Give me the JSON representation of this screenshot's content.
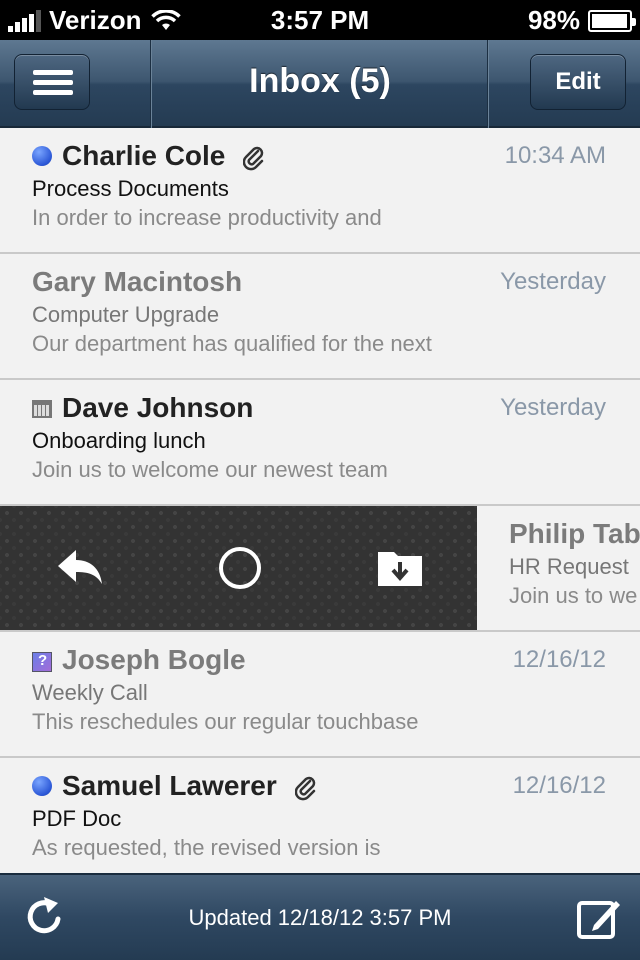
{
  "status_bar": {
    "carrier": "Verizon",
    "time": "3:57 PM",
    "battery": "98%"
  },
  "nav": {
    "title": "Inbox (5)",
    "edit_label": "Edit",
    "menu_icon": "hamburger-icon"
  },
  "messages": [
    {
      "sender": "Charlie Cole",
      "subject": "Process Documents",
      "preview": "In order to increase productivity and",
      "time": "10:34 AM",
      "unread": true,
      "attachment": true
    },
    {
      "sender": "Gary Macintosh",
      "subject": "Computer Upgrade",
      "preview": "Our department has qualified for the next",
      "time": "Yesterday",
      "unread": false,
      "attachment": false
    },
    {
      "sender": "Dave Johnson",
      "subject": "Onboarding lunch",
      "preview": "Join us to welcome our newest team",
      "time": "Yesterday",
      "unread": false,
      "attachment": false,
      "icon": "calendar-icon"
    },
    {
      "sender": "Philip Tab",
      "subject": "HR Request",
      "preview": "Join us to we",
      "swiped": true
    },
    {
      "sender": "Joseph Bogle",
      "subject": "Weekly Call",
      "preview": "This reschedules our regular touchbase",
      "time": "12/16/12",
      "unread": false,
      "icon": "meeting-request-icon"
    },
    {
      "sender": "Samuel Lawerer",
      "subject": "PDF Doc",
      "preview": "As requested, the revised version is",
      "time": "12/16/12",
      "unread": true,
      "attachment": true
    }
  ],
  "swipe_actions": [
    "reply-icon",
    "mark-circle-icon",
    "archive-folder-icon"
  ],
  "toolbar": {
    "updated_text": "Updated 12/18/12 3:57 PM",
    "refresh_icon": "refresh-icon",
    "compose_icon": "compose-icon"
  },
  "colors": {
    "nav_bar": "#3d566f",
    "unread_dot": "#2b57d6",
    "time_text": "#8a98a8"
  }
}
